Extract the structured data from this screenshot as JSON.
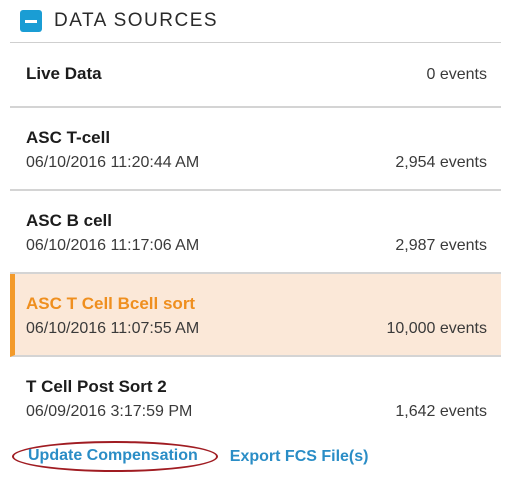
{
  "header": {
    "title": "DATA SOURCES"
  },
  "live": {
    "name": "Live Data",
    "events": "0 events"
  },
  "sources": [
    {
      "name": "ASC T-cell",
      "timestamp": "06/10/2016 11:20:44 AM",
      "events": "2,954 events",
      "selected": false
    },
    {
      "name": "ASC B cell",
      "timestamp": "06/10/2016 11:17:06 AM",
      "events": "2,987 events",
      "selected": false
    },
    {
      "name": "ASC T Cell Bcell sort",
      "timestamp": "06/10/2016 11:07:55 AM",
      "events": "10,000 events",
      "selected": true
    },
    {
      "name": "T Cell Post Sort 2",
      "timestamp": "06/09/2016 3:17:59 PM",
      "events": "1,642 events",
      "selected": false
    }
  ],
  "actions": {
    "update_compensation": "Update Compensation",
    "export_fcs": "Export FCS File(s)"
  },
  "colors": {
    "accent": "#1a9dd4",
    "selected_bar": "#f39a2a",
    "selected_bg": "#fbe8d8",
    "selected_text": "#ef8f1f",
    "link": "#2a8dc6",
    "highlight_ring": "#a01c22"
  },
  "icons": {
    "collapse": "minus-square-icon"
  }
}
